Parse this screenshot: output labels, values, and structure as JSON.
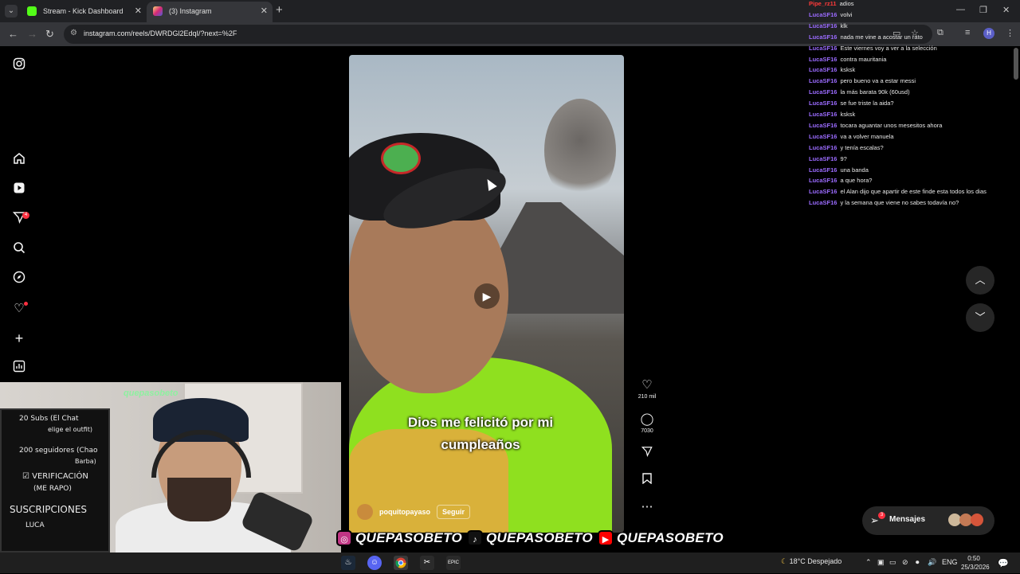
{
  "browser": {
    "tabs": [
      {
        "label": "Stream - Kick Dashboard",
        "active": false,
        "favicon_color": "#53fc18"
      },
      {
        "label": "(3) Instagram",
        "active": true,
        "favicon_color": "#e1306c"
      }
    ],
    "url": "instagram.com/reels/DWRDGl2EdqI/?next=%2F"
  },
  "instagram": {
    "sidebar_badge_count": "4",
    "reel": {
      "caption": "Dios me felicitó por mi cumpleaños",
      "author": "poquitopayaso",
      "follow_label": "Seguir",
      "likes": "210 mil",
      "comments": "7030"
    },
    "messages_label": "Mensajes",
    "messages_badge": "3"
  },
  "chat": [
    {
      "user": "Pipe_rz11",
      "message": "adios",
      "highlight": true
    },
    {
      "user": "LucaSF16",
      "message": "volvi"
    },
    {
      "user": "LucaSF16",
      "message": "klk"
    },
    {
      "user": "LucaSF16",
      "message": "nada me vine a acostar un rato"
    },
    {
      "user": "LucaSF16",
      "message": "Este viernes voy a ver a la selección"
    },
    {
      "user": "LucaSF16",
      "message": "contra mauritania"
    },
    {
      "user": "LucaSF16",
      "message": "ksksk"
    },
    {
      "user": "LucaSF16",
      "message": "pero bueno va a estar messi"
    },
    {
      "user": "LucaSF16",
      "message": "la más barata 90k (60usd)"
    },
    {
      "user": "LucaSF16",
      "message": "se fue triste la aida?"
    },
    {
      "user": "LucaSF16",
      "message": "ksksk"
    },
    {
      "user": "LucaSF16",
      "message": "tocara aguantar unos mesesitos ahora"
    },
    {
      "user": "LucaSF16",
      "message": "va a volver manuela"
    },
    {
      "user": "LucaSF16",
      "message": "y tenía escalas?"
    },
    {
      "user": "LucaSF16",
      "message": "9?"
    },
    {
      "user": "LucaSF16",
      "message": "una banda"
    },
    {
      "user": "LucaSF16",
      "message": "a que hora?"
    },
    {
      "user": "LucaSF16",
      "message": "el Alan dijo que apartir de este finde esta todos los dias"
    },
    {
      "user": "LucaSF16",
      "message": "y la semana que viene no sabes todavía no?"
    }
  ],
  "webcam": {
    "handle": "quepasobeto",
    "board_lines": [
      "20 Subs (El Chat",
      "elige el outfit)",
      "200 seguidores (Chao",
      "Barba)",
      "☑ VERIFICACIÓN",
      "(ME RAPO)",
      "SUSCRIPCIONES",
      "LUCA"
    ]
  },
  "socials": [
    {
      "icon": "instagram-icon",
      "handle": "QUEPASOBETO",
      "color": "#c13584"
    },
    {
      "icon": "tiktok-icon",
      "handle": "QUEPASOBETO",
      "color": "#111111"
    },
    {
      "icon": "youtube-icon",
      "handle": "QUEPASOBETO",
      "color": "#ff0000"
    }
  ],
  "taskbar": {
    "weather": "18°C  Despejado",
    "language": "ENG",
    "time": "0:50",
    "date": "25/3/2026"
  }
}
